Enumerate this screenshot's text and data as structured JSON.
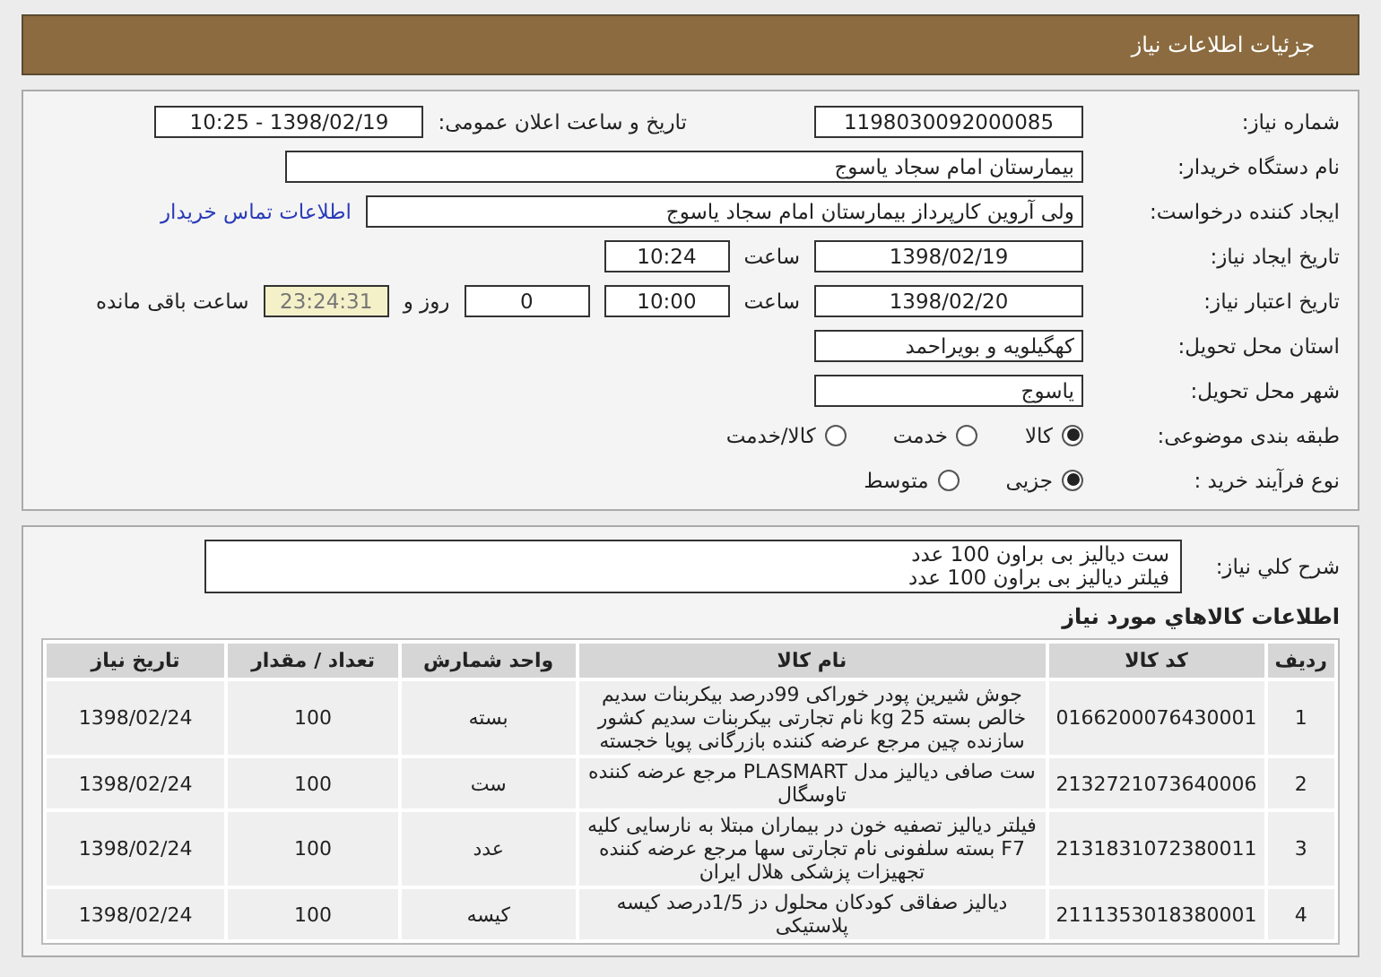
{
  "header": {
    "title": "جزئیات اطلاعات نیاز"
  },
  "need_number": {
    "label": "شماره نیاز:",
    "value": "1198030092000085"
  },
  "announce": {
    "label": "تاریخ و ساعت اعلان عمومی:",
    "value": "1398/02/19 - 10:25"
  },
  "buyer": {
    "label": "نام دستگاه خریدار:",
    "value": "بیمارستان امام سجاد یاسوج"
  },
  "requester": {
    "label": "ایجاد کننده درخواست:",
    "value": "ولی آروین کارپرداز بیمارستان امام سجاد یاسوج",
    "link": "اطلاعات تماس خریدار"
  },
  "creation": {
    "label": "تاریخ ایجاد نیاز:",
    "date": "1398/02/19",
    "time_label": "ساعت",
    "time": "10:24"
  },
  "validity": {
    "label": "تاریخ اعتبار نیاز:",
    "date": "1398/02/20",
    "time_label": "ساعت",
    "time": "10:00",
    "days": "0",
    "days_label": "روز و",
    "remaining": "23:24:31",
    "remaining_label": "ساعت باقی مانده"
  },
  "province": {
    "label": "استان محل تحویل:",
    "value": "کهگیلویه و بویراحمد"
  },
  "city": {
    "label": "شهر محل تحویل:",
    "value": "یاسوج"
  },
  "category": {
    "label": "طبقه بندی موضوعی:",
    "options": [
      {
        "label": "کالا",
        "selected": true
      },
      {
        "label": "خدمت",
        "selected": false
      },
      {
        "label": "کالا/خدمت",
        "selected": false
      }
    ]
  },
  "purchase_type": {
    "label": "نوع فرآیند خرید :",
    "options": [
      {
        "label": "جزیی",
        "selected": true
      },
      {
        "label": "متوسط",
        "selected": false
      }
    ]
  },
  "description": {
    "label": "شرح کلي نياز:",
    "lines": [
      "ست دیالیز بی براون 100 عدد",
      "فیلتر دیالیز بی براون 100 عدد"
    ]
  },
  "goods": {
    "title": "اطلاعات کالاهاي مورد نياز",
    "columns": [
      "ردیف",
      "کد کالا",
      "نام کالا",
      "واحد شمارش",
      "تعداد / مقدار",
      "تاریخ نیاز"
    ],
    "rows": [
      {
        "index": "1",
        "code": "0166200076430001",
        "name": "جوش شیرین پودر خوراکی 99درصد بیکربنات سدیم خالص بسته 25 kg نام تجارتی بیکربنات سدیم کشور سازنده چین مرجع عرضه کننده بازرگانی پویا خجسته",
        "unit": "بسته",
        "qty": "100",
        "date": "1398/02/24"
      },
      {
        "index": "2",
        "code": "2132721073640006",
        "name": "ست صافی دیالیز مدل PLASMART مرجع عرضه کننده تاوسگال",
        "unit": "ست",
        "qty": "100",
        "date": "1398/02/24"
      },
      {
        "index": "3",
        "code": "2131831072380011",
        "name": "فیلتر دیالیز تصفیه خون در بیماران مبتلا به نارسایی کلیه F7 بسته سلفونی نام تجارتی سها مرجع عرضه کننده تجهیزات پزشکی هلال ایران",
        "unit": "عدد",
        "qty": "100",
        "date": "1398/02/24"
      },
      {
        "index": "4",
        "code": "2111353018380001",
        "name": "دیالیز صفاقی کودکان محلول دز 1/5درصد کیسه پلاستیکی",
        "unit": "کیسه",
        "qty": "100",
        "date": "1398/02/24"
      }
    ]
  }
}
